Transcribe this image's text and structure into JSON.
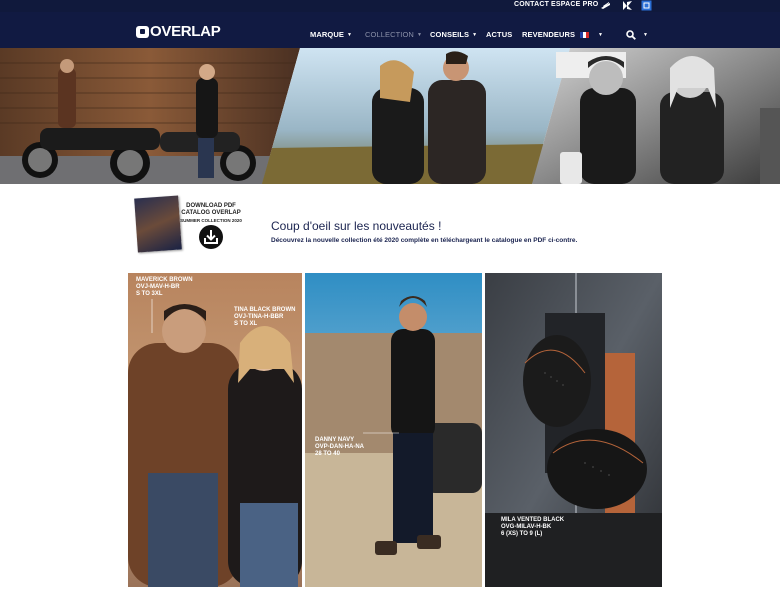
{
  "topbar": {
    "contact": "CONTACT",
    "espace_pro": "ESPACE PRO",
    "brand_icons": [
      "brand-logo-1-icon",
      "brand-logo-2-icon",
      "brand-logo-3-icon"
    ]
  },
  "header": {
    "logo_text": "OVERLAP",
    "nav": [
      {
        "label": "MARQUE",
        "dropdown": true
      },
      {
        "label": "COLLECTION",
        "dropdown": true
      },
      {
        "label": "CONSEILS",
        "dropdown": true
      },
      {
        "label": "ACTUS",
        "dropdown": false
      },
      {
        "label": "REVENDEURS",
        "dropdown": false
      }
    ],
    "language_icon": "french-flag-icon",
    "search_icon": "search-icon"
  },
  "promo": {
    "catalog_line1": "DOWNLOAD PDF",
    "catalog_line2": "CATALOG OVERLAP",
    "catalog_line3": "SUMMER COLLECTION 2020",
    "download_icon": "download-icon",
    "title": "Coup d'oeil sur les nouveautés !",
    "subtitle": "Découvrez la nouvelle collection été 2020 complète en téléchargeant le catalogue en PDF ci-contre."
  },
  "products": {
    "tile1": {
      "label1_name": "MAVERICK BROWN",
      "label1_ref": "OVJ-MAV-H-BR",
      "label1_size": "S TO 3XL",
      "label2_name": "TINA BLACK BROWN",
      "label2_ref": "OVJ-TINA-H-BBR",
      "label2_size": "S TO XL"
    },
    "tile2": {
      "label_name": "DANNY NAVY",
      "label_ref": "OVP-DAN-HA-NA",
      "label_size": "28 TO 40"
    },
    "tile3": {
      "label_name": "MILA VENTED BLACK",
      "label_ref": "OVG-MILAV-H-BK",
      "label_size": "6 (XS) TO 9 (L)"
    }
  },
  "colors": {
    "navy": "#111a42",
    "topbar": "#10193c",
    "text_navy": "#1b2450"
  }
}
